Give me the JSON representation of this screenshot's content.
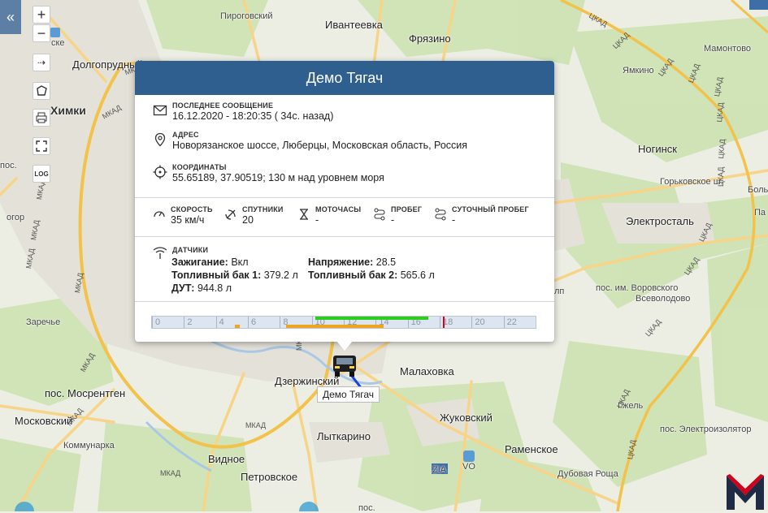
{
  "map": {
    "places": [
      {
        "name": "Пироговский",
        "cls": "small"
      },
      {
        "name": "Ивантеевка",
        "cls": "big"
      },
      {
        "name": "Фрязино",
        "cls": "big"
      },
      {
        "name": "Мамонтово",
        "cls": "small"
      },
      {
        "name": "Долгопрудный",
        "cls": "big"
      },
      {
        "name": "Химки",
        "cls": "bold"
      },
      {
        "name": "Ямкино",
        "cls": "small"
      },
      {
        "name": "Ногинск",
        "cls": "big"
      },
      {
        "name": "Электросталь",
        "cls": "big"
      },
      {
        "name": "пос. им. Воровского",
        "cls": "small"
      },
      {
        "name": "Всеволодово",
        "cls": "small"
      },
      {
        "name": "Заречье",
        "cls": "small"
      },
      {
        "name": "Дзержинский",
        "cls": "big"
      },
      {
        "name": "Малаховка",
        "cls": "big"
      },
      {
        "name": "пос. Мосрентген",
        "cls": "big"
      },
      {
        "name": "Московский",
        "cls": "big"
      },
      {
        "name": "Жуковский",
        "cls": "big"
      },
      {
        "name": "Коммунарка",
        "cls": "small"
      },
      {
        "name": "Лыткарино",
        "cls": "big"
      },
      {
        "name": "Раменское",
        "cls": "big"
      },
      {
        "name": "Видное",
        "cls": "big"
      },
      {
        "name": "Петровское",
        "cls": "big"
      },
      {
        "name": "Дубовая Роща",
        "cls": "small"
      },
      {
        "name": "Гжель",
        "cls": "small"
      },
      {
        "name": "пос. Электроизолятор",
        "cls": "small"
      },
      {
        "name": "Горьковское ш.",
        "cls": "small"
      },
      {
        "name": "Боль",
        "cls": "small"
      },
      {
        "name": "Па",
        "cls": "small"
      },
      {
        "name": "лп",
        "cls": "small"
      },
      {
        "name": "пос.",
        "cls": "small"
      },
      {
        "name": "пос.",
        "cls": "small"
      },
      {
        "name": "огор",
        "cls": "small"
      },
      {
        "name": "ске",
        "cls": "small"
      },
      {
        "name": "VO",
        "cls": "small"
      },
      {
        "name": "ZIA",
        "cls": "small"
      },
      {
        "name": "M-5",
        "cls": "small"
      }
    ],
    "road_labels": [
      "ЦКАД",
      "ЦКАД",
      "ЦКАД",
      "ЦКАД",
      "ЦКАД",
      "ЦКАД",
      "ЦКАД",
      "ЦКАД",
      "ЦКАД",
      "ЦКАД",
      "ЦКАД",
      "ЦКАД",
      "ЦКАД",
      "МКАД",
      "МКАД",
      "МКАД",
      "МКАД",
      "МКАД",
      "МКАД",
      "МКАД",
      "МКАД",
      "МКАД",
      "МКАД",
      "МКАД"
    ]
  },
  "toolbar": {
    "collapse": "«",
    "zoom_in": "+",
    "zoom_out": "−",
    "route": "⇢",
    "log_label": "LOG"
  },
  "popup": {
    "title": "Демо Тягач",
    "last_message_label": "ПОСЛЕДНЕЕ СООБЩЕНИЕ",
    "last_message_value": "16.12.2020 - 18:20:35  ( 34с. назад)",
    "address_label": "АДРЕС",
    "address_value": "Новорязанское шоссе, Люберцы, Московская область, Россия",
    "coords_label": "КООРДИНАТЫ",
    "coords_value": "55.65189, 37.90519; 130 м над уровнем моря",
    "stats": [
      {
        "label": "СКОРОСТЬ",
        "value": "35 км/ч",
        "icon": "speedometer-icon"
      },
      {
        "label": "СПУТНИКИ",
        "value": "20",
        "icon": "satellite-icon"
      },
      {
        "label": "МОТОЧАСЫ",
        "value": "-",
        "icon": "hourglass-icon"
      },
      {
        "label": "ПРОБЕГ",
        "value": "-",
        "icon": "route-icon"
      },
      {
        "label": "СУТОЧНЫЙ ПРОБЕГ",
        "value": "-",
        "icon": "route-icon"
      }
    ],
    "sensors_label": "ДАТЧИКИ",
    "sensors": {
      "ignition_key": "Зажигание:",
      "ignition_val": " Вкл",
      "voltage_key": "Напряжение:",
      "voltage_val": " 28.5",
      "tank1_key": "Топливный бак 1:",
      "tank1_val": " 379.2 л",
      "tank2_key": "Топливный бак 2:",
      "tank2_val": " 565.6 л",
      "dut_key": "ДУТ:",
      "dut_val": " 944.8 л"
    },
    "timeline": {
      "ticks": [
        "0",
        "2",
        "4",
        "6",
        "8",
        "10",
        "12",
        "14",
        "16",
        "18",
        "20",
        "22"
      ],
      "current_hour": 18.2,
      "green_segment": [
        10.2,
        17.3
      ],
      "orange_segments": [
        [
          5.2,
          5.5
        ],
        [
          8.4,
          14.5
        ]
      ],
      "colors": {
        "green": "#2ecc1f",
        "orange": "#f0a520",
        "marker": "#d0021b"
      }
    }
  },
  "vehicle": {
    "label": "Демо Тягач"
  },
  "colors": {
    "header": "#2f5f8f",
    "accent": "#5d7fa6"
  }
}
